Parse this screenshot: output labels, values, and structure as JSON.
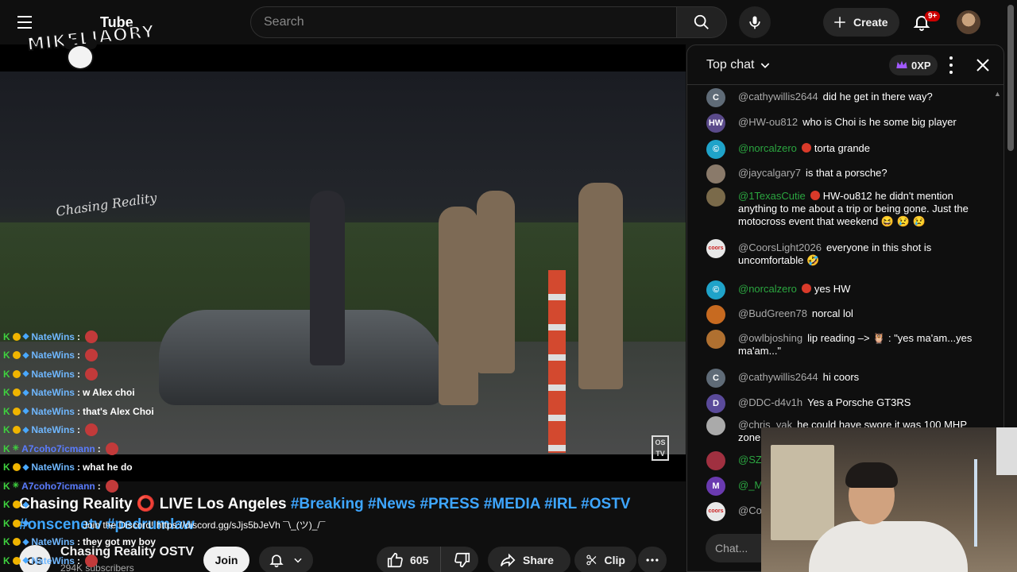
{
  "topbar": {
    "logo_text": "MIKELIAORY",
    "logo_suffix": "Tube",
    "search_placeholder": "Search",
    "create_label": "Create",
    "notifications_count": "9+"
  },
  "video": {
    "watermark_left": "Chasing Reality",
    "watermark_right": "OS TV"
  },
  "overlay_chat": [
    {
      "name": "NateWins",
      "msg": ""
    },
    {
      "name": "NateWins",
      "msg": ""
    },
    {
      "name": "NateWins",
      "msg": ""
    },
    {
      "name": "NateWins",
      "msg": "w Alex choi"
    },
    {
      "name": "NateWins",
      "msg": "that's Alex Choi"
    },
    {
      "name": "NateWins",
      "msg": ""
    },
    {
      "name": "A7coho7icmann",
      "msg": ""
    },
    {
      "name": "NateWins",
      "msg": "what he do"
    },
    {
      "name": "A7coho7icmann",
      "msg": ""
    },
    {
      "name": "",
      "msg": ""
    },
    {
      "name": "",
      "msg": ""
    },
    {
      "name": "NateWins",
      "msg": "they got my boy"
    },
    {
      "name": "NateWins",
      "msg": ""
    }
  ],
  "overlay_discord": "Join the Discord! https://discord.gg/sJjs5bJeVh ¯\\_(ツ)_/¯",
  "info": {
    "title_main": "Chasing Reality ⭕ LIVE Los Angeles",
    "tags": "#Breaking #News #PRESS #MEDIA #IRL #OSTV",
    "tags_line2": "#onscenetv #pedrumlaw",
    "channel_name": "Chasing Reality OSTV",
    "channel_avatar": "OS",
    "subscribers": "294K subscribers",
    "join_label": "Join",
    "like_count": "605",
    "share_label": "Share",
    "clip_label": "Clip"
  },
  "chat": {
    "header": "Top chat",
    "xp": "0XP",
    "input_placeholder": "Chat...",
    "messages": [
      {
        "author": "@cathywillis2644",
        "text": "did he get in there way?",
        "avatar": "C",
        "color": "#5f6b77",
        "member": false
      },
      {
        "author": "@HW-ou812",
        "text": "who is Choi is he some big player",
        "avatar": "HW",
        "color": "#5a4a8a",
        "member": false
      },
      {
        "author": "@norcalzero",
        "text": "torta grande",
        "avatar": "©",
        "color": "#1fa3c9",
        "member": true
      },
      {
        "author": "@jaycalgary7",
        "text": "is that a porsche?",
        "avatar": "",
        "color": "#8a7a6a",
        "member": false
      },
      {
        "author": "@1TexasCutie",
        "text": "HW-ou812 he didn't mention anything to me about a trip or being gone. Just the motocross event that weekend 😆 😢 😢",
        "avatar": "",
        "color": "#7a6a4a",
        "member": true
      },
      {
        "author": "@CoorsLight2026",
        "text": "everyone in this shot is uncomfortable 🤣",
        "avatar": "coors",
        "color": "#e8e8e8",
        "member": false
      },
      {
        "author": "@norcalzero",
        "text": "yes HW",
        "avatar": "©",
        "color": "#1fa3c9",
        "member": true
      },
      {
        "author": "@BudGreen78",
        "text": "norcal lol",
        "avatar": "",
        "color": "#c76a20",
        "member": false
      },
      {
        "author": "@owlbjoshing",
        "text": "lip reading –> 🦉 : \"yes ma'am...yes ma'am...\"",
        "avatar": "",
        "color": "#b07030",
        "member": false
      },
      {
        "author": "@cathywillis2644",
        "text": "hi coors",
        "avatar": "C",
        "color": "#5f6b77",
        "member": false
      },
      {
        "author": "@DDC-d4v1h",
        "text": "Yes a Porsche GT3RS",
        "avatar": "D",
        "color": "#5a4a9a",
        "member": false
      },
      {
        "author": "@chris_yak",
        "text": "he could have swore it was 100 MHP zone",
        "avatar": "",
        "color": "#aaa",
        "member": false
      },
      {
        "author": "@SZ",
        "text": "",
        "avatar": "",
        "color": "#a03040",
        "member": true
      },
      {
        "author": "@_M",
        "text": "",
        "avatar": "M",
        "color": "#6a3ab0",
        "member": true
      },
      {
        "author": "@Co",
        "text": "",
        "avatar": "coors",
        "color": "#e8e8e8",
        "member": false
      }
    ]
  }
}
